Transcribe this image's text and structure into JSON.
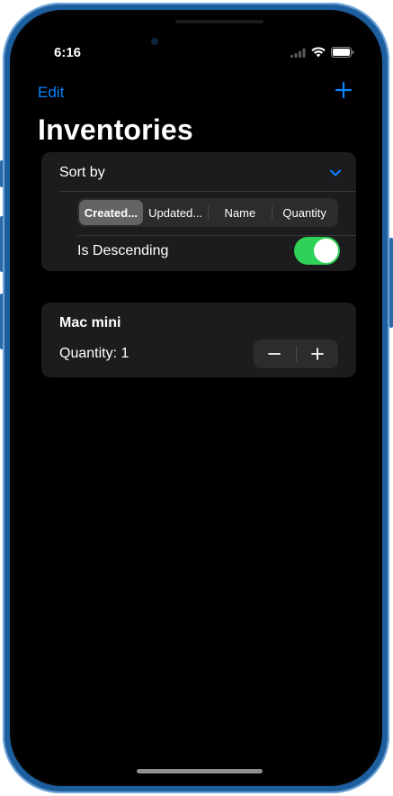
{
  "status_bar": {
    "time": "6:16",
    "wifi_icon": "wifi-icon",
    "battery_icon": "battery-icon",
    "signal_icon": "cellular-signal-icon"
  },
  "nav": {
    "edit_label": "Edit",
    "add_icon": "plus-icon",
    "title": "Inventories"
  },
  "sort": {
    "label": "Sort by",
    "expand_icon": "chevron-down-icon",
    "options": [
      "Created...",
      "Updated...",
      "Name",
      "Quantity"
    ],
    "selected_index": 0,
    "descending_label": "Is Descending",
    "descending": true
  },
  "items": [
    {
      "name": "Mac mini",
      "quantity_text": "Quantity: 1",
      "decrement_icon": "minus-icon",
      "increment_icon": "plus-icon"
    }
  ],
  "colors": {
    "accent": "#0a84ff",
    "toggle_on": "#30d158",
    "card": "#1c1c1e",
    "background": "#000000",
    "frame": "#1d5f9e"
  }
}
